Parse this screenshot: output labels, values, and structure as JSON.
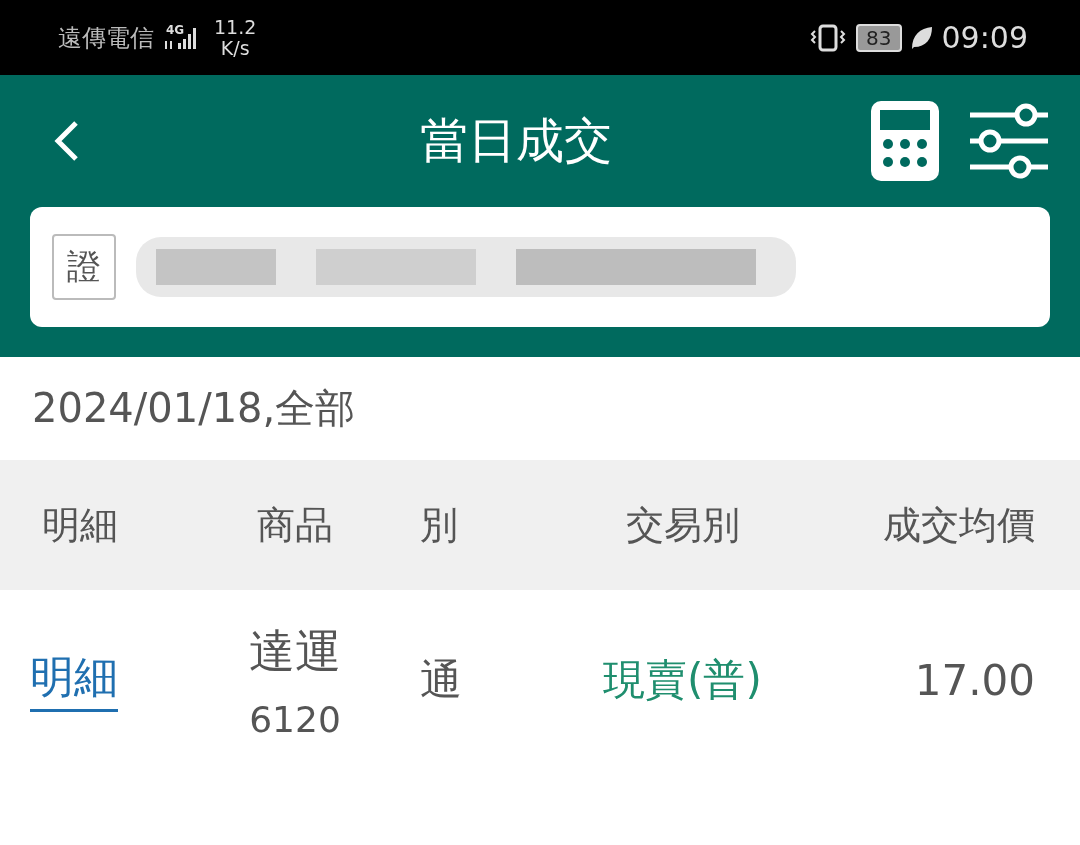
{
  "status_bar": {
    "carrier": "遠傳電信",
    "network": "4G",
    "speed": "11.2",
    "speed_unit": "K/s",
    "battery": "83",
    "time": "09:09"
  },
  "header": {
    "title": "當日成交"
  },
  "account": {
    "tag": "證"
  },
  "date_filter": "2024/01/18,全部",
  "table": {
    "columns": [
      "明細",
      "商品",
      "別",
      "交易別",
      "成交均價"
    ],
    "rows": [
      {
        "detail": "明細",
        "name": "達運",
        "code": "6120",
        "column_3": "通",
        "trade_type": "現賣(普)",
        "avg_price": "17.00"
      }
    ]
  }
}
